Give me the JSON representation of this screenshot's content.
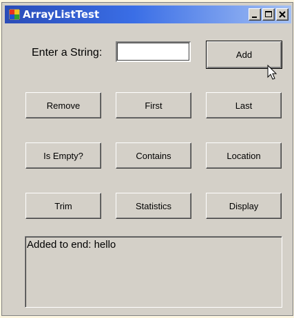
{
  "window": {
    "title": "ArrayListTest"
  },
  "form": {
    "label": "Enter a String:",
    "input_value": ""
  },
  "buttons": {
    "add": "Add",
    "remove": "Remove",
    "first": "First",
    "last": "Last",
    "is_empty": "Is Empty?",
    "contains": "Contains",
    "location": "Location",
    "trim": "Trim",
    "statistics": "Statistics",
    "display": "Display"
  },
  "output": {
    "text": "Added to end: hello"
  },
  "icons": {
    "app": "app-window-icon",
    "minimize": "minimize-icon",
    "maximize": "maximize-icon",
    "close": "close-icon",
    "cursor": "mouse-pointer-icon"
  },
  "colors": {
    "titlebar_start": "#2a4cb8",
    "titlebar_end": "#a4c0f4",
    "face": "#d4d0c8"
  }
}
